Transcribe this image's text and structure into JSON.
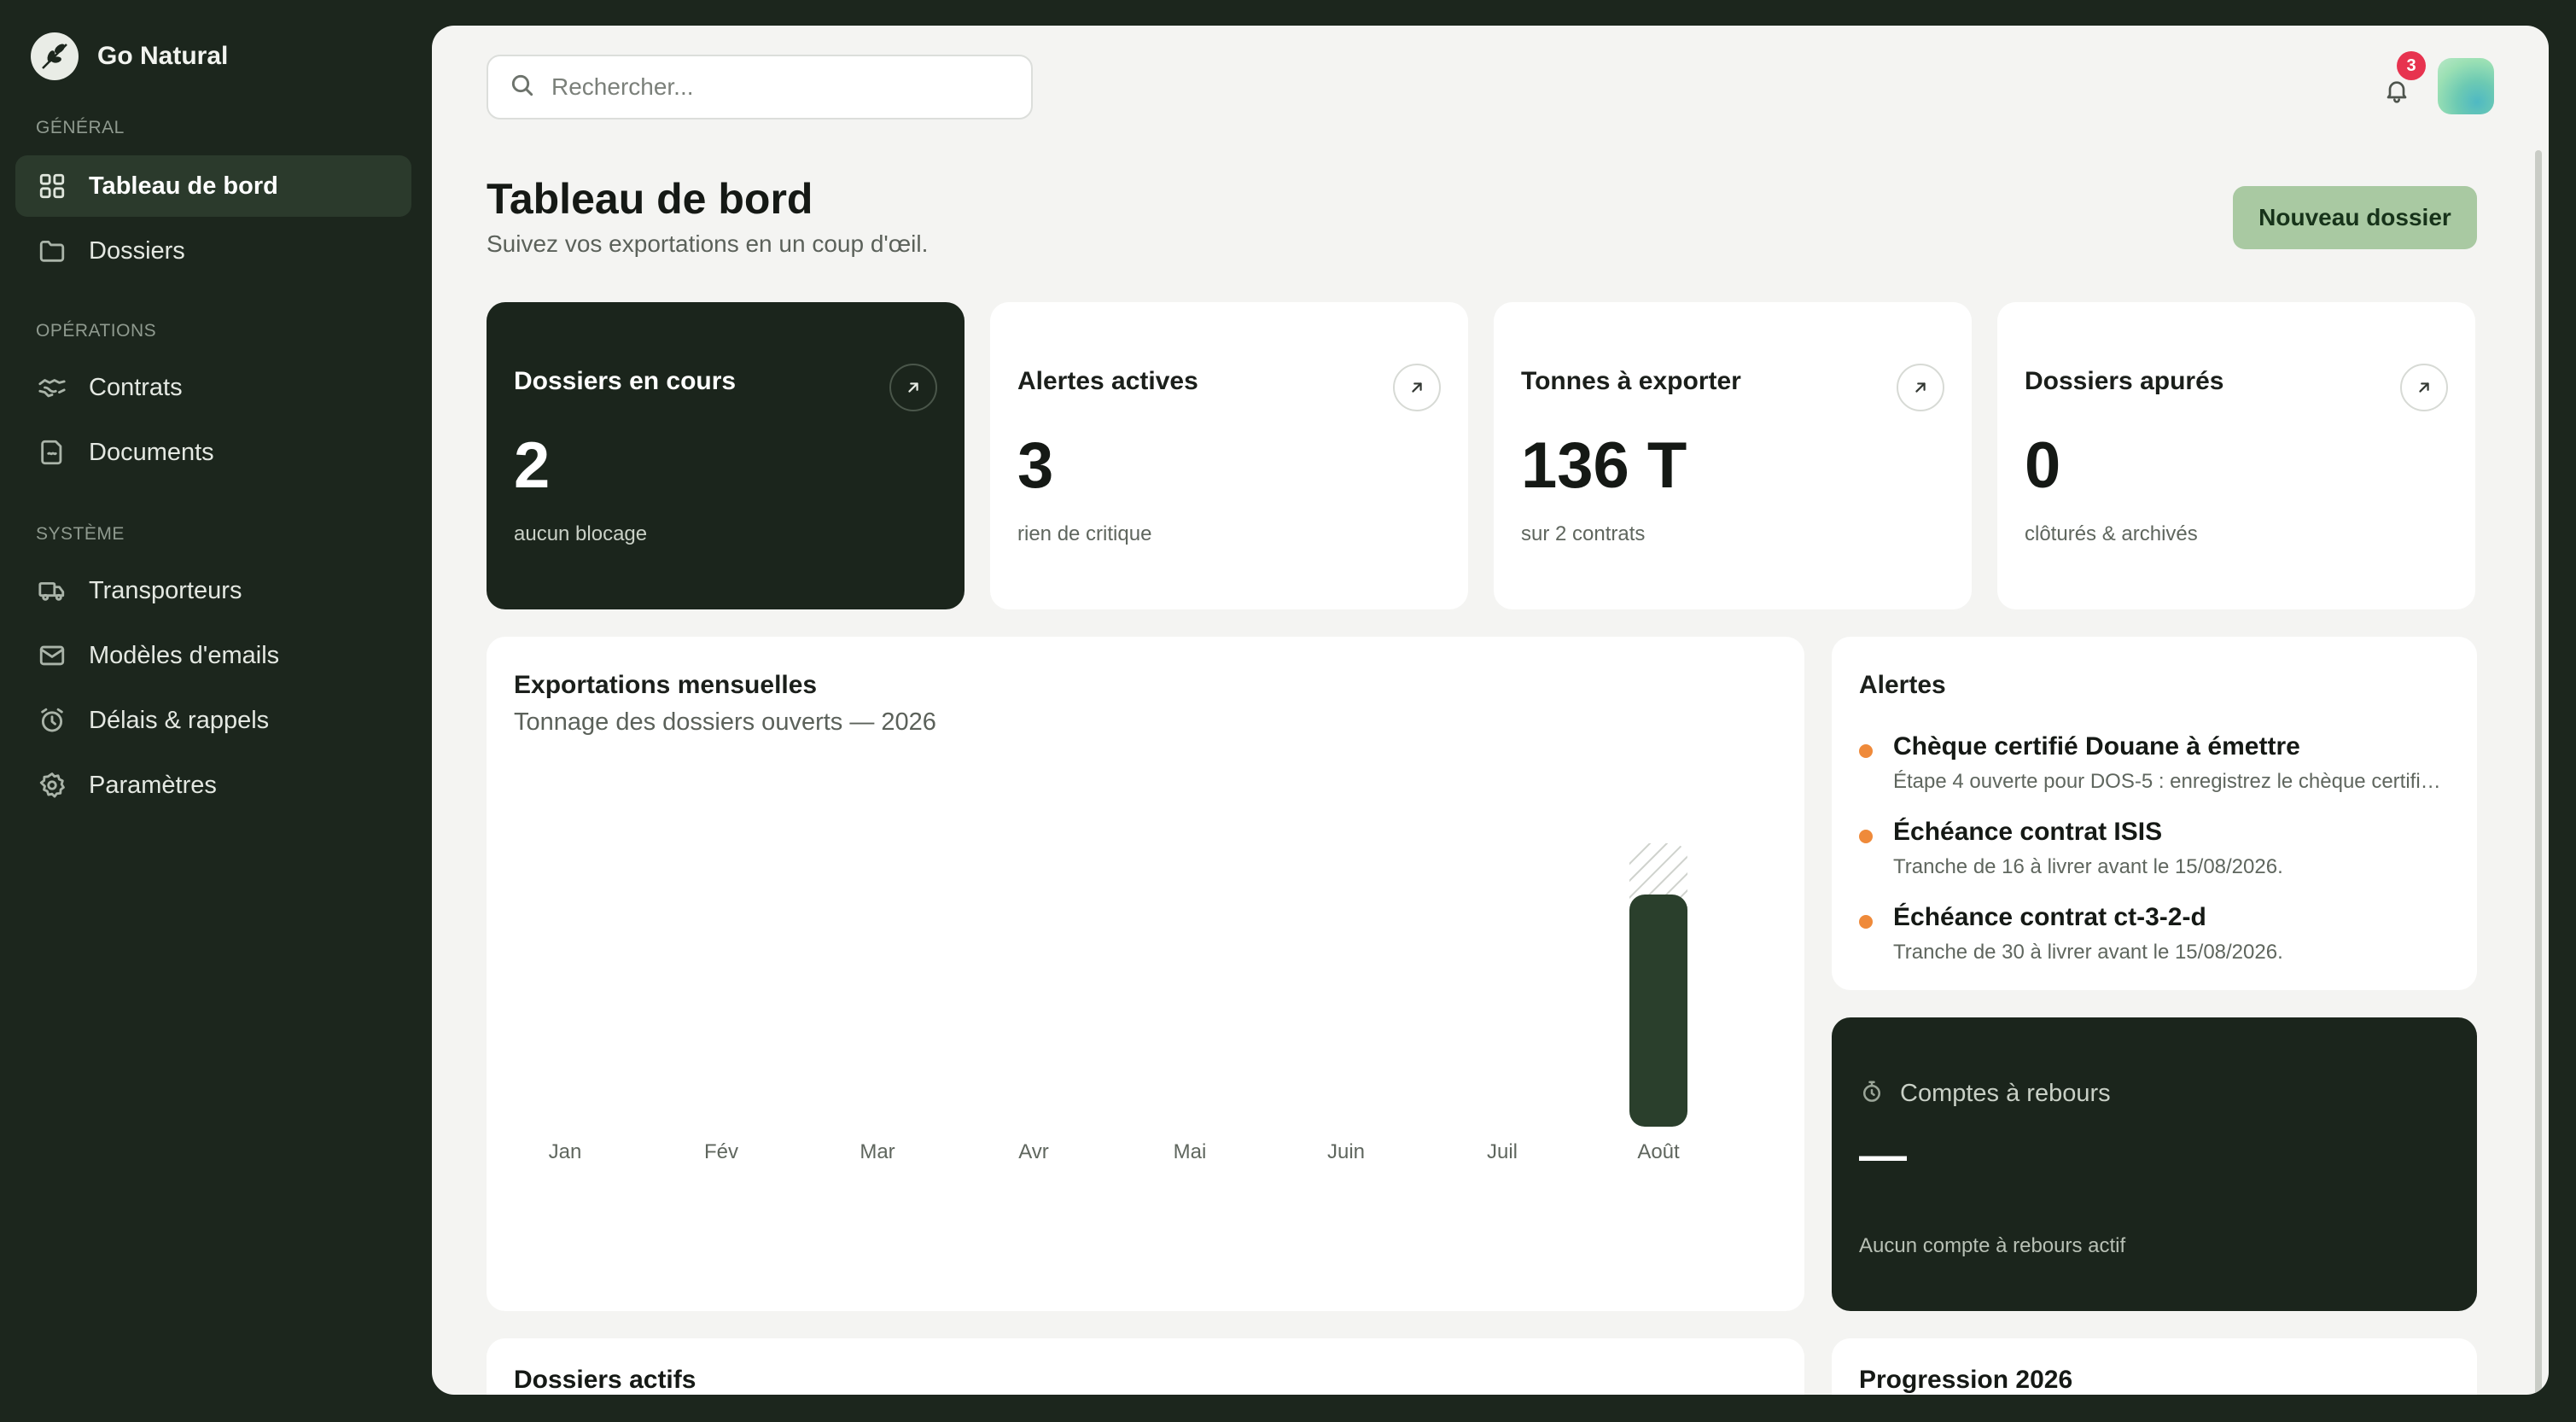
{
  "brand": {
    "name": "Go Natural",
    "logo_icon": "leaf-logo-icon"
  },
  "sidebar": {
    "sections": [
      {
        "label": "GÉNÉRAL",
        "items": [
          {
            "label": "Tableau de bord",
            "icon": "grid-icon",
            "active": true
          },
          {
            "label": "Dossiers",
            "icon": "folder-icon",
            "active": false
          }
        ]
      },
      {
        "label": "OPÉRATIONS",
        "items": [
          {
            "label": "Contrats",
            "icon": "handshake-icon",
            "active": false
          },
          {
            "label": "Documents",
            "icon": "document-icon",
            "active": false
          }
        ]
      },
      {
        "label": "SYSTÈME",
        "items": [
          {
            "label": "Transporteurs",
            "icon": "truck-icon",
            "active": false
          },
          {
            "label": "Modèles d'emails",
            "icon": "mail-icon",
            "active": false
          },
          {
            "label": "Délais & rappels",
            "icon": "alarm-clock-icon",
            "active": false
          },
          {
            "label": "Paramètres",
            "icon": "gear-icon",
            "active": false
          }
        ]
      }
    ]
  },
  "header": {
    "search_placeholder": "Rechercher...",
    "notifications_count": "3"
  },
  "page": {
    "title": "Tableau de bord",
    "subtitle": "Suivez vos exportations en un coup d'œil.",
    "new_button": "Nouveau dossier"
  },
  "stats": [
    {
      "label": "Dossiers en cours",
      "value": "2",
      "note": "aucun blocage",
      "dark": true
    },
    {
      "label": "Alertes actives",
      "value": "3",
      "note": "rien de critique",
      "dark": false
    },
    {
      "label": "Tonnes à exporter",
      "value": "136 T",
      "note": "sur 2 contrats",
      "dark": false
    },
    {
      "label": "Dossiers apurés",
      "value": "0",
      "note": "clôturés & archivés",
      "dark": false
    }
  ],
  "chart": {
    "title": "Exportations mensuelles",
    "subtitle": "Tonnage des dossiers ouverts — 2026"
  },
  "chart_data": {
    "type": "bar",
    "categories": [
      "Jan",
      "Fév",
      "Mar",
      "Avr",
      "Mai",
      "Juin",
      "Juil",
      "Août"
    ],
    "values": [
      0,
      0,
      0,
      0,
      0,
      0,
      0,
      136
    ],
    "hatched_extra": [
      0,
      0,
      0,
      0,
      0,
      0,
      0,
      30
    ],
    "title": "Exportations mensuelles",
    "subtitle": "Tonnage des dossiers ouverts — 2026",
    "ylim": [
      0,
      170
    ],
    "grid": false,
    "colors": {
      "bar": "#2a3f2c",
      "hatch": "#cfd2cd"
    }
  },
  "alerts": {
    "title": "Alertes",
    "items": [
      {
        "title": "Chèque certifié Douane à émettre",
        "desc": "Étape 4 ouverte pour DOS-5 : enregistrez le chèque certifié…"
      },
      {
        "title": "Échéance contrat ISIS",
        "desc": "Tranche de 16 à livrer avant le 15/08/2026."
      },
      {
        "title": "Échéance contrat ct-3-2-d",
        "desc": "Tranche de 30 à livrer avant le 15/08/2026."
      }
    ]
  },
  "countdown": {
    "title": "Comptes à rebours",
    "value": "—",
    "note": "Aucun compte à rebours actif"
  },
  "bottom": {
    "left_title": "Dossiers actifs",
    "right_title": "Progression 2026"
  },
  "colors": {
    "sidebar_bg": "#1c261d",
    "accent_button": "#a9c9a2",
    "alert_dot": "#ef8a3a",
    "badge": "#e7334f"
  }
}
